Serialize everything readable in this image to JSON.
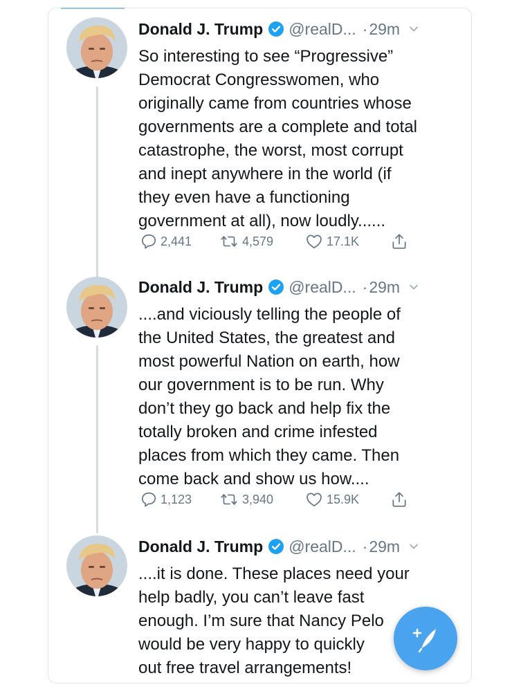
{
  "tweets": [
    {
      "name": "Donald J. Trump",
      "handle": "@realD...",
      "dot": "·",
      "time": "29m",
      "text": "So interesting to see “Progressive”\nDemocrat Congresswomen, who\noriginally came from countries whose\ngovernments are a complete and total\ncatastrophe, the worst, most corrupt\nand inept anywhere in the world (if\nthey even have a functioning\ngovernment at all), now loudly......",
      "replies": "2,441",
      "retweets": "4,579",
      "likes": "17.1K"
    },
    {
      "name": "Donald J. Trump",
      "handle": "@realD...",
      "dot": "·",
      "time": "29m",
      "text": "....and viciously telling the people of\nthe United States, the greatest and\nmost powerful Nation on earth, how\nour government is to be run. Why\ndon’t they go back and help fix the\ntotally broken and crime infested\nplaces from which they came. Then\ncome back and show us how....",
      "replies": "1,123",
      "retweets": "3,940",
      "likes": "15.9K"
    },
    {
      "name": "Donald J. Trump",
      "handle": "@realD...",
      "dot": "·",
      "time": "29m",
      "text": "....it is done. These places need your\nhelp badly, you can’t leave fast\nenough. I’m sure that Nancy Pelo\nwould be very happy to quickly\nout free travel arrangements!"
    }
  ],
  "colors": {
    "text": "#14171a",
    "secondary": "#657786",
    "verified": "#1da1f2",
    "fab": "#4aa3ee"
  },
  "icons": [
    "verified-badge-icon",
    "chevron-down-icon",
    "reply-icon",
    "retweet-icon",
    "like-icon",
    "share-icon",
    "compose-tweet-icon"
  ]
}
